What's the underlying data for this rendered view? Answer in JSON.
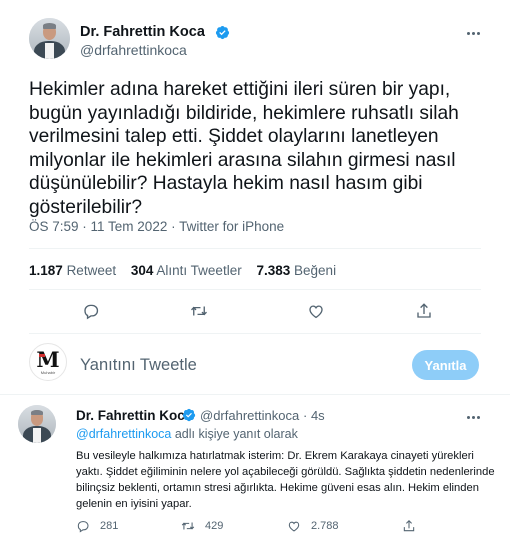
{
  "colors": {
    "accent": "#1d9bf0",
    "muted": "#536471",
    "text": "#0f1419",
    "button_disabled": "#8ecdf8"
  },
  "main_tweet": {
    "author_name": "Dr. Fahrettin Koca",
    "handle": "@drfahrettinkoca",
    "text": "Hekimler adına hareket ettiğini ileri süren bir yapı, bugün yayınladığı bildiride, hekimlere ruhsatlı silah verilmesini talep etti. Şiddet olaylarını lanetleyen milyonlar ile hekimleri arasına silahın girmesi nasıl düşünülebilir? Hastayla hekim nasıl hasım gibi gösterilebilir?",
    "meta": "ÖS 7:59 · 11 Tem 2022 · Twitter for iPhone",
    "stats": {
      "retweets_count": "1.187",
      "retweets_label": "Retweet",
      "quotes_count": "304",
      "quotes_label": "Alıntı Tweetler",
      "likes_count": "7.383",
      "likes_label": "Beğeni"
    },
    "actions": [
      "reply-icon",
      "retweet-icon",
      "like-icon",
      "share-icon"
    ]
  },
  "compose": {
    "placeholder": "Yanıtını Tweetle",
    "button_label": "Yanıtla",
    "avatar_letter": "M",
    "avatar_caption": "Muhabir"
  },
  "reply_tweet": {
    "author_name": "Dr. Fahrettin Koca",
    "handle": "@drfahrettinkoca",
    "time": "· 4s",
    "replying_mention": "@drfahrettinkoca",
    "replying_suffix": " adlı kişiye yanıt olarak",
    "text": "Bu vesileyle halkımıza hatırlatmak isterim: Dr. Ekrem Karakaya cinayeti yürekleri yaktı. Şiddet eğiliminin nelere yol açabileceği görüldü. Sağlıkta şiddetin nedenlerinde bilinçsiz beklenti, ortamın stresi ağırlıkta. Hekime güveni esas alın. Hekim elinden gelenin en iyisini yapar.",
    "reply_count": "281",
    "retweet_count": "429",
    "like_count": "2.788"
  }
}
